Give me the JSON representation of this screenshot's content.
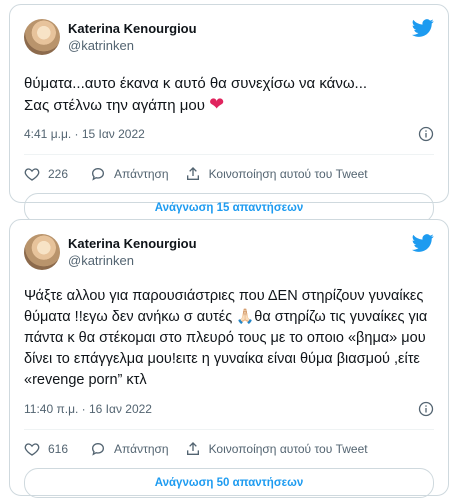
{
  "tweets": [
    {
      "author": {
        "display_name": "Katerina Kenourgiou",
        "handle": "@katrinken",
        "avatar_icon": "avatar-photo"
      },
      "text": "θύματα...αυτο έκανα κ αυτό θα συνεχίσω να κάνω...\nΣας στέλνω την αγάπη μου",
      "emoji": "❤",
      "timestamp": "4:41 μ.μ. · 15 Ιαν 2022",
      "likes": "226",
      "reply_label": "Απάντηση",
      "share_label": "Κοινοποίηση αυτού του Tweet",
      "replies_button": "Ανάγνωση 15 απαντήσεων"
    },
    {
      "author": {
        "display_name": "Katerina Kenourgiou",
        "handle": "@katrinken",
        "avatar_icon": "avatar-photo"
      },
      "text": "Ψάξτε αλλου για παρουσιάστριες που ΔΕΝ στηρίζουν γυναίκες θύματα !!εγω δεν ανήκω σ αυτές 🙏🏻θα στηρίζω τις γυναίκες για πάντα κ θα στέκομαι στο πλευρό τους με το οποιο «βημα» μου δίνει το επάγγελμα μου!ειτε η γυναίκα είναι θύμα βιασμού ,είτε «revenge porn” κτλ",
      "timestamp": "11:40 π.μ. · 16 Ιαν 2022",
      "likes": "616",
      "reply_label": "Απάντηση",
      "share_label": "Κοινοποίηση αυτού του Tweet",
      "replies_button": "Ανάγνωση 50 απαντήσεων"
    }
  ],
  "colors": {
    "accent": "#1d9bf0",
    "heart": "#e0245e",
    "muted": "#536471",
    "border": "#cfd9de"
  },
  "icons": [
    "twitter-bird-icon",
    "info-icon",
    "heart-icon",
    "reply-icon",
    "share-icon"
  ]
}
